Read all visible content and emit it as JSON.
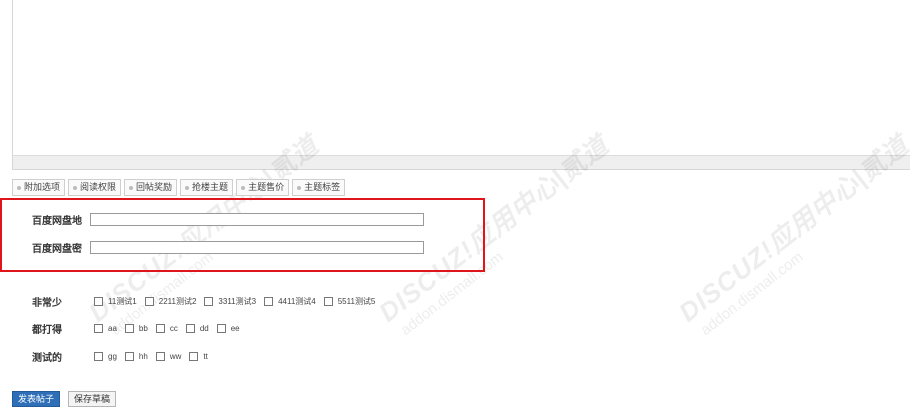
{
  "tabs": [
    {
      "label": "附加选项"
    },
    {
      "label": "阅读权限"
    },
    {
      "label": "回帖奖励"
    },
    {
      "label": "抢楼主题"
    },
    {
      "label": "主题售价"
    },
    {
      "label": "主题标签"
    }
  ],
  "fields": {
    "address_label": "百度网盘地",
    "password_label": "百度网盘密",
    "address_value": "",
    "password_value": ""
  },
  "groups": [
    {
      "label": "非常少",
      "options": [
        "11测试1",
        "2211测试2",
        "3311测试3",
        "4411测试4",
        "5511测试5"
      ]
    },
    {
      "label": "都打得",
      "options": [
        "aa",
        "bb",
        "cc",
        "dd",
        "ee"
      ]
    },
    {
      "label": "测试的",
      "options": [
        "gg",
        "hh",
        "ww",
        "tt"
      ]
    }
  ],
  "buttons": {
    "submit_label": "发表帖子",
    "draft_label": "保存草稿"
  },
  "watermark": {
    "brand": "DISCUZ!应用中心|贰道",
    "url": "addon.dismall.com"
  },
  "colors": {
    "highlight_border": "#e0141b",
    "primary_button": "#2f6fb8"
  }
}
